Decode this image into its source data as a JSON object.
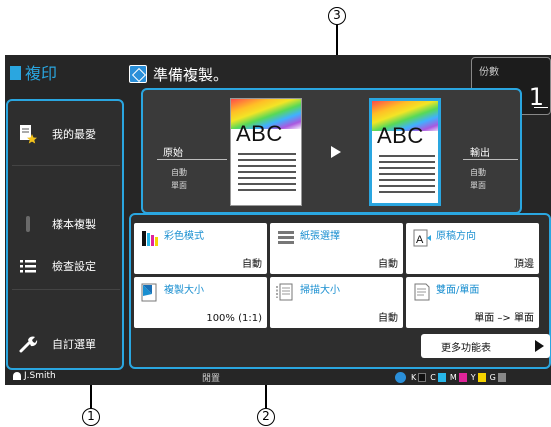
{
  "app": {
    "title": "複印"
  },
  "status": {
    "message": "準備複製。"
  },
  "copies": {
    "label": "份數",
    "value": "1"
  },
  "sidebar": {
    "items": [
      {
        "label": "我的最愛",
        "icon": "favorites-icon"
      },
      {
        "label": "樣本複製",
        "icon": "sample-copy-icon"
      },
      {
        "label": "檢查設定",
        "icon": "checklist-icon"
      },
      {
        "label": "自訂選單",
        "icon": "wrench-icon"
      }
    ]
  },
  "preview": {
    "original": {
      "label": "原始",
      "line1": "自動",
      "line2": "單面",
      "text": "ABC"
    },
    "output": {
      "label": "輸出",
      "line1": "自動",
      "line2": "單面",
      "text": "ABC"
    }
  },
  "functions": {
    "items": [
      {
        "name": "彩色模式",
        "value": "自動",
        "icon": "color-mode-icon"
      },
      {
        "name": "紙張選擇",
        "value": "自動",
        "icon": "paper-tray-icon"
      },
      {
        "name": "原稿方向",
        "value": "頂邊",
        "icon": "orientation-icon"
      },
      {
        "name": "複製大小",
        "value": "100% (1:1)",
        "icon": "reduce-enlarge-icon"
      },
      {
        "name": "掃描大小",
        "value": "自動",
        "icon": "scan-size-icon"
      },
      {
        "name": "雙面/單面",
        "value": "單面 –> 單面",
        "icon": "duplex-icon"
      }
    ],
    "more_label": "更多功能表"
  },
  "bottom": {
    "user": "J.Smith",
    "status": "閒置",
    "toner": [
      "K",
      "C",
      "M",
      "Y",
      "G"
    ],
    "toner_colors": [
      "#111111",
      "#27b6e8",
      "#e0249a",
      "#f5d300",
      "#888888"
    ]
  },
  "callouts": [
    "1",
    "2",
    "3"
  ],
  "colors": {
    "accent": "#2aa6e0",
    "screen_bg": "#262626",
    "text_link": "#1a8fd0"
  }
}
